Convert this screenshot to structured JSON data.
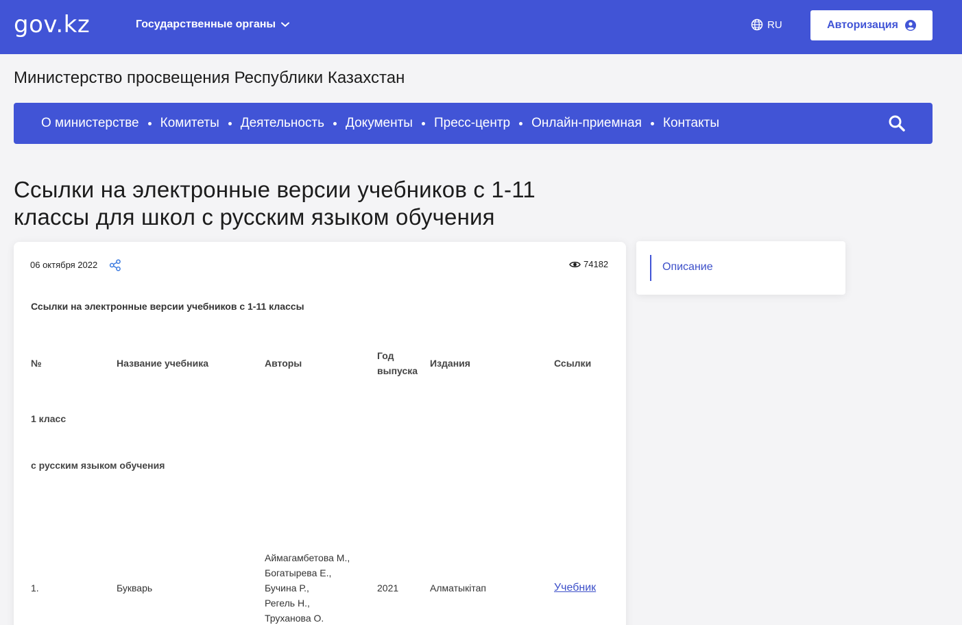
{
  "header": {
    "logo": "gov.kz",
    "gov_organs": "Государственные органы",
    "lang": "RU",
    "auth": "Авторизация"
  },
  "ministry": "Министерство просвещения Республики Казахстан",
  "nav": {
    "items": [
      "О министерстве",
      "Комитеты",
      "Деятельность",
      "Документы",
      "Пресс-центр",
      "Онлайн-приемная",
      "Контакты"
    ]
  },
  "page_title": "Ссылки на электронные версии учебников с 1-11 классы для школ с русским языком обучения",
  "article": {
    "date": "06 октября 2022",
    "views": "74182",
    "intro": "Ссылки на электронные версии учебников с 1-11 классы",
    "columns": [
      "№",
      "Название учебника",
      "Авторы",
      "Год выпуска",
      "Издания",
      "Ссылки"
    ],
    "section_grade": "1 класс",
    "section_lang": "с русским языком обучения",
    "rows": [
      {
        "num": "1.",
        "title": "Букварь",
        "authors": [
          "Аймагамбетова М.,",
          "Богатырева Е.,",
          "Бучина Р.,",
          "Регель Н.,",
          "Труханова О."
        ],
        "year": "2021",
        "publisher": "Алматыкітап",
        "link": "Учебник"
      }
    ]
  },
  "sidebar": {
    "link": "Описание"
  },
  "colors": {
    "brand": "#4154d6",
    "link": "#3c4fc9",
    "background": "#f4f4f6"
  }
}
